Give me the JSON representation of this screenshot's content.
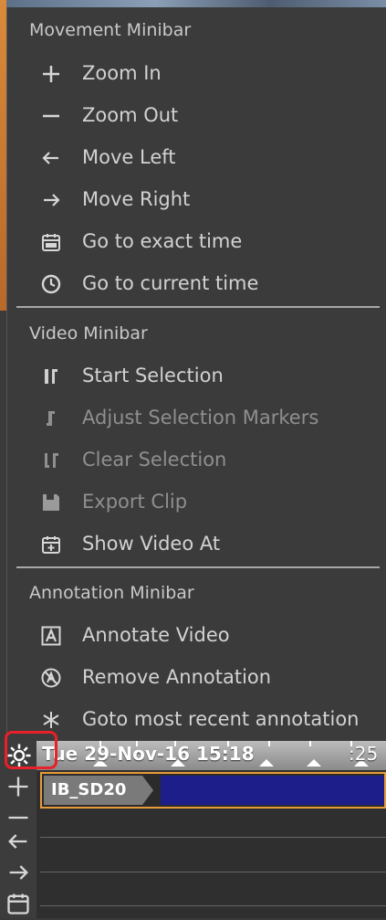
{
  "menu": {
    "movement": {
      "title": "Movement Minibar",
      "items": [
        {
          "label": "Zoom In",
          "icon": "plus-icon"
        },
        {
          "label": "Zoom Out",
          "icon": "minus-icon"
        },
        {
          "label": "Move Left",
          "icon": "arrow-left-icon"
        },
        {
          "label": "Move Right",
          "icon": "arrow-right-icon"
        },
        {
          "label": "Go to exact time",
          "icon": "calendar-icon"
        },
        {
          "label": "Go to current time",
          "icon": "clock-icon"
        }
      ]
    },
    "video": {
      "title": "Video Minibar",
      "items": [
        {
          "label": "Start Selection",
          "icon": "start-selection-icon"
        },
        {
          "label": "Adjust Selection Markers",
          "icon": "adjust-marker-icon"
        },
        {
          "label": "Clear Selection",
          "icon": "clear-selection-icon"
        },
        {
          "label": "Export Clip",
          "icon": "save-icon"
        },
        {
          "label": "Show Video At",
          "icon": "calendar-plus-icon"
        }
      ]
    },
    "annotation": {
      "title": "Annotation Minibar",
      "items": [
        {
          "label": "Annotate Video",
          "icon": "annotate-icon"
        },
        {
          "label": "Remove Annotation",
          "icon": "remove-annotation-icon"
        },
        {
          "label": "Goto most recent annotation",
          "icon": "asterisk-icon"
        }
      ]
    }
  },
  "timeline": {
    "date": "Tue 29-Nov-16 15:18",
    "tick_label": ":25",
    "track_label": "IB_SD20",
    "colors": {
      "track_bar": "#1e1e8a",
      "track_border": "#e79a3a",
      "highlight": "#e8202a"
    }
  }
}
